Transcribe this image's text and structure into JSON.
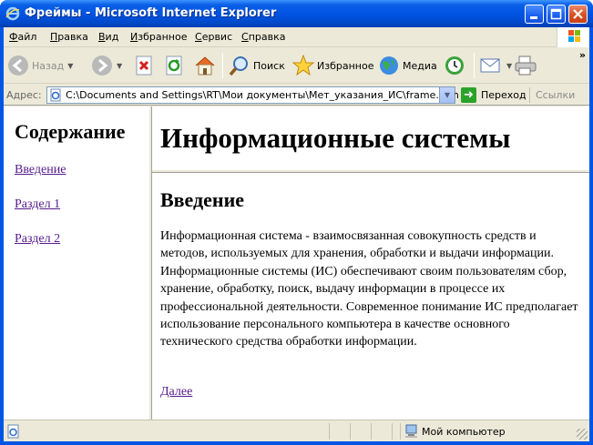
{
  "window": {
    "title": "Фреймы - Microsoft Internet Explorer"
  },
  "menu": {
    "items": [
      "Файл",
      "Правка",
      "Вид",
      "Избранное",
      "Сервис",
      "Справка"
    ]
  },
  "toolbar": {
    "back_label": "Назад",
    "search_label": "Поиск",
    "favorites_label": "Избранное",
    "media_label": "Медиа",
    "more": "»"
  },
  "address": {
    "label": "Адрес:",
    "value": "C:\\Documents and Settings\\RT\\Мои документы\\Мет_указания_ИС\\frame.htm",
    "go_label": "Переход",
    "links_label": "Ссылки"
  },
  "left_frame": {
    "heading": "Содержание",
    "links": [
      "Введение",
      "Раздел 1",
      "Раздел 2"
    ]
  },
  "top_frame": {
    "heading": "Информационные системы"
  },
  "main_frame": {
    "heading": "Введение",
    "paragraph": "Информационная система - взаимосвязанная совокупность средств и методов, используемых для хранения, обработки и выдачи информации. Информационные системы (ИС) обеспечивают своим пользователям сбор, хранение, обработку, поиск, выдачу информации в процессе их профессиональной деятельности. Современное понимание ИС предполагает использование персонального компьютера в качестве основного технического средства обработки информации.",
    "next_link": "Далее"
  },
  "status": {
    "zone": "Мой компьютер"
  }
}
